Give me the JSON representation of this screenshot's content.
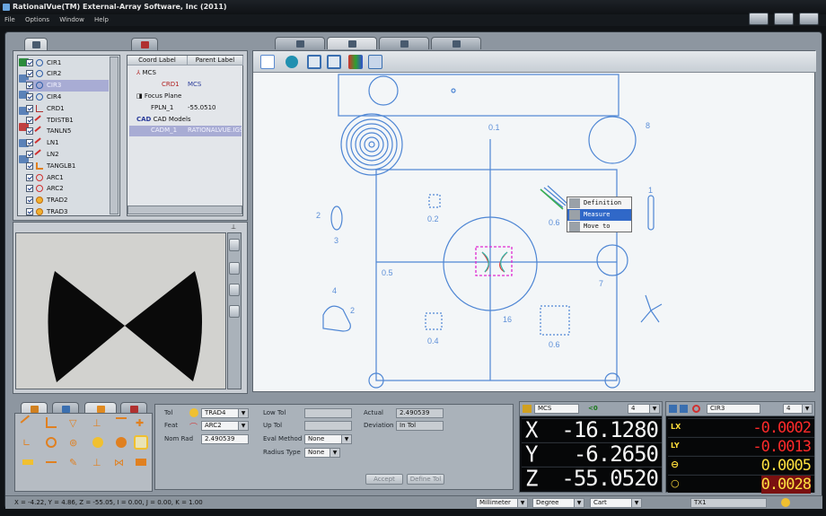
{
  "window": {
    "title": "RationalVue(TM) External-Array Software, Inc (2011)"
  },
  "menu": [
    "File",
    "Options",
    "Window",
    "Help"
  ],
  "features": [
    {
      "label": "CIR1",
      "icon": "circle-icon"
    },
    {
      "label": "CIR2",
      "icon": "circle-icon"
    },
    {
      "label": "CIR3",
      "icon": "circle-icon",
      "selected": true
    },
    {
      "label": "CIR4",
      "icon": "circle-icon"
    },
    {
      "label": "CRD1",
      "icon": "coordinate-icon"
    },
    {
      "label": "TDISTB1",
      "icon": "distance-icon"
    },
    {
      "label": "TANLN5",
      "icon": "tangent-line-icon"
    },
    {
      "label": "LN1",
      "icon": "line-icon"
    },
    {
      "label": "LN2",
      "icon": "line-icon"
    },
    {
      "label": "TANGLB1",
      "icon": "angle-icon"
    },
    {
      "label": "ARC1",
      "icon": "arc-icon"
    },
    {
      "label": "ARC2",
      "icon": "arc-icon"
    },
    {
      "label": "TRAD2",
      "icon": "radius-icon"
    },
    {
      "label": "TRAD3",
      "icon": "radius-icon"
    }
  ],
  "coord_tree": {
    "headers": [
      "Coord Label",
      "Parent Label"
    ],
    "mcs": "MCS",
    "crd1": {
      "label": "CRD1",
      "parent": "MCS"
    },
    "focus_plane": "Focus Plane",
    "fpln1": {
      "label": "FPLN_1",
      "parent": "-55.0510"
    },
    "cad_models": "CAD Models",
    "cadm1": {
      "label": "CADM_1",
      "parent": "RATIONALVUE.IGS"
    }
  },
  "context_menu": [
    "Definition",
    "Measure",
    "Move to"
  ],
  "cad_labels": {
    "a": "0.1",
    "b": "8",
    "c": "1",
    "d": "2",
    "e": "3",
    "f": "0.2",
    "g": "0.6",
    "h": "0.5",
    "i": "7",
    "j": "4",
    "k": "2",
    "l": "0.4",
    "m": "16",
    "n": "0.6"
  },
  "props": {
    "tol_label": "Tol",
    "tol_value": "TRAD4",
    "feat_label": "Feat",
    "feat_value": "ARC2",
    "nomrad_label": "Nom Rad",
    "nomrad_value": "2.490539",
    "lowtol_label": "Low Tol",
    "uptol_label": "Up Tol",
    "evalmethod_label": "Eval Method",
    "evalmethod_value": "None",
    "radiustype_label": "Radius Type",
    "radiustype_value": "None",
    "actual_label": "Actual",
    "actual_value": "2.490539",
    "deviation_label": "Deviation",
    "deviation_value": "In Tol",
    "accept_label": "Accept",
    "definetol_label": "Define Tol"
  },
  "dro": {
    "coord_system": "MCS",
    "mode_indicator": "<0",
    "precision": "4",
    "x": "-16.1280",
    "y": "-6.2650",
    "z": "-55.0520"
  },
  "tolerance": {
    "feature": "CIR3",
    "precision": "4",
    "lx_label": "LX",
    "lx": "-0.0002",
    "ly_label": "LY",
    "ly": "-0.0013",
    "form_label": "⊖",
    "form": "0.0005",
    "circ_label": "○",
    "circ": "0.0028",
    "colors": {
      "negative": "#ff2a2a",
      "positive": "#ffe040"
    }
  },
  "status": {
    "coords": "X = -4.22, Y = 4.86, Z = -55.05, I = 0.00, J = 0.00, K = 1.00",
    "units": "Millimeter",
    "angle": "Degree",
    "system": "Cart",
    "tx": "TX1"
  }
}
